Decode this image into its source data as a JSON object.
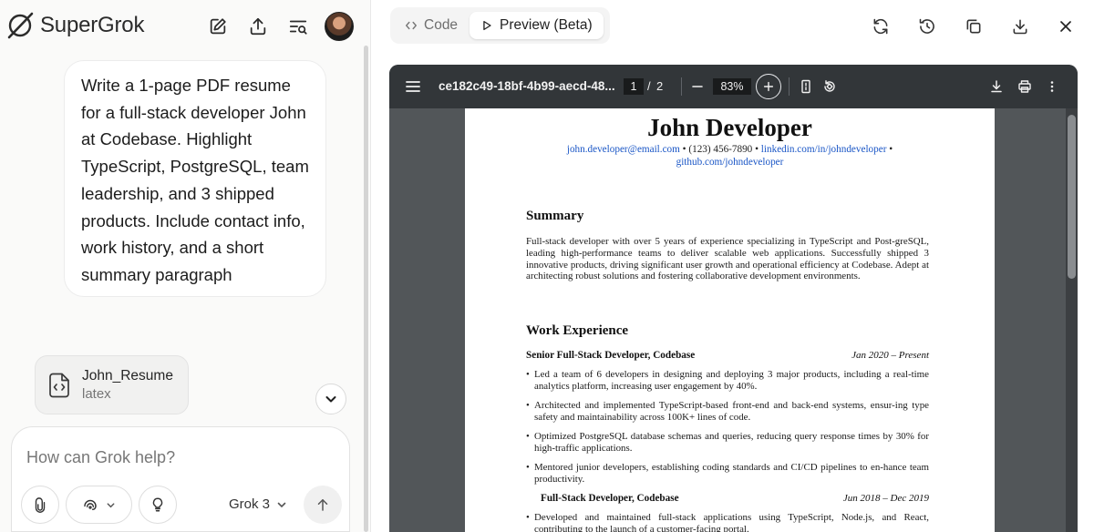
{
  "app": {
    "name": "SuperGrok"
  },
  "chat": {
    "user_message": "Write a 1-page PDF resume for a full-stack developer John at Codebase. Highlight TypeScript, PostgreSQL, team leadership, and 3 shipped products. Include contact info, work history, and a short summary paragraph",
    "attachment": {
      "name": "John_Resume",
      "type": "latex",
      "icon": "code-file-icon"
    }
  },
  "composer": {
    "placeholder": "How can Grok help?",
    "model": "Grok 3"
  },
  "preview": {
    "tabs": [
      {
        "label": "Code",
        "active": false
      },
      {
        "label": "Preview (Beta)",
        "active": true
      }
    ]
  },
  "pdf_viewer": {
    "filename": "ce182c49-18bf-4b99-aecd-48...",
    "current_page": "1",
    "separator": "/",
    "total_pages": "2",
    "zoom": "83%"
  },
  "resume": {
    "name": "John Developer",
    "email": "john.developer@email.com",
    "sep1": " • (123) 456-7890 • ",
    "linkedin": "linkedin.com/in/johndeveloper",
    "sep2": " •",
    "github": "github.com/johndeveloper",
    "summary_heading": "Summary",
    "summary": "Full-stack developer with over 5 years of experience specializing in TypeScript and Post-greSQL, leading high-performance teams to deliver scalable web applications. Successfully shipped 3 innovative products, driving significant user growth and operational efficiency at Codebase. Adept at architecting robust solutions and fostering collaborative development environments.",
    "work_heading": "Work Experience",
    "jobs": [
      {
        "role": "Senior Full-Stack Developer, Codebase",
        "dates": "Jan 2020 – Present",
        "bullets": [
          "Led a team of 6 developers in designing and deploying 3 major products, including a real-time analytics platform, increasing user engagement by 40%.",
          "Architected and implemented TypeScript-based front-end and back-end systems, ensur-ing type safety and maintainability across 100K+ lines of code.",
          "Optimized PostgreSQL database schemas and queries, reducing query response times by 30% for high-traffic applications.",
          "Mentored junior developers, establishing coding standards and CI/CD pipelines to en-hance team productivity."
        ]
      },
      {
        "role": "Full-Stack Developer, Codebase",
        "dates": "Jun 2018 – Dec 2019",
        "bullets": [
          "Developed and maintained full-stack applications using TypeScript, Node.js, and React, contributing to the launch of a customer-facing portal."
        ]
      }
    ]
  }
}
